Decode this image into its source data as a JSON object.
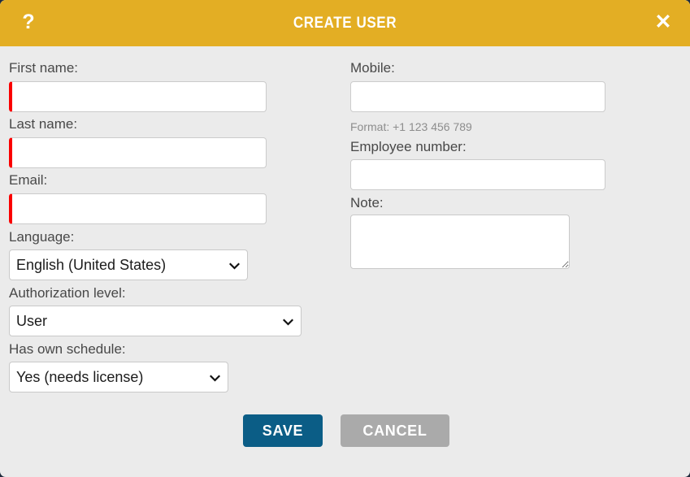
{
  "header": {
    "title": "CREATE USER",
    "help_icon": "question-mark-icon",
    "help_glyph": "?",
    "close_icon": "close-icon",
    "close_glyph": "✕",
    "background_color": "#e3ae24",
    "text_color": "#ffffff"
  },
  "colors": {
    "body_background": "#ebebeb",
    "backdrop": "#1f2b3d",
    "required_marker": "#fa0000",
    "save_button": "#0b5d86",
    "cancel_button": "#aaaaaa",
    "label_text": "#484848",
    "hint_text": "#8d8d8d"
  },
  "left_column": {
    "first_name": {
      "label": "First name:",
      "value": "",
      "placeholder": "",
      "required": true
    },
    "last_name": {
      "label": "Last name:",
      "value": "",
      "placeholder": "",
      "required": true
    },
    "email": {
      "label": "Email:",
      "value": "",
      "placeholder": "",
      "required": true
    },
    "language": {
      "label": "Language:",
      "selected": "English (United States)",
      "options": [
        "English (United States)"
      ]
    },
    "authorization_level": {
      "label": "Authorization level:",
      "selected": "User",
      "options": [
        "User"
      ]
    },
    "has_own_schedule": {
      "label": "Has own schedule:",
      "selected": "Yes (needs license)",
      "options": [
        "Yes (needs license)"
      ]
    }
  },
  "right_column": {
    "mobile": {
      "label": "Mobile:",
      "value": "",
      "placeholder": "",
      "hint": "Format: +1 123 456 789"
    },
    "employee_number": {
      "label": "Employee number:",
      "value": "",
      "placeholder": ""
    },
    "note": {
      "label": "Note:",
      "value": "",
      "placeholder": ""
    }
  },
  "footer": {
    "save_label": "SAVE",
    "cancel_label": "CANCEL"
  }
}
